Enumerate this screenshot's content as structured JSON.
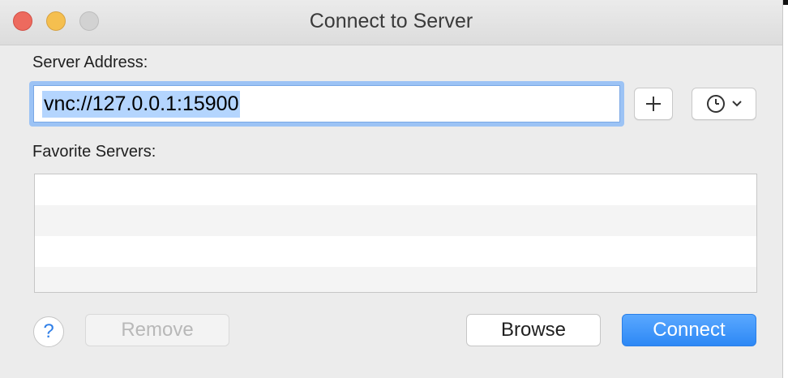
{
  "window": {
    "title": "Connect to Server"
  },
  "server_address": {
    "label": "Server Address:",
    "value": "vnc://127.0.0.1:15900"
  },
  "toolbar": {
    "add_icon": "plus-icon",
    "recent_icon": "clock-icon"
  },
  "favorites": {
    "label": "Favorite Servers:",
    "items": []
  },
  "buttons": {
    "help": "?",
    "remove": "Remove",
    "browse": "Browse",
    "connect": "Connect"
  },
  "colors": {
    "accent": "#2d88f5",
    "selection": "#b4d5fe",
    "close": "#ed6a5e",
    "minimize": "#f5bf4f",
    "zoom": "#d2d2d2"
  }
}
